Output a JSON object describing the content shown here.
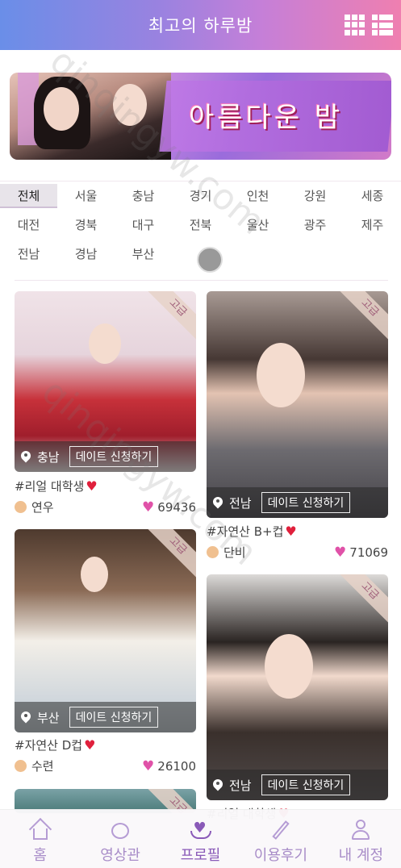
{
  "header": {
    "title": "최고의 하루밤",
    "icons": [
      "grid-icon",
      "list-icon"
    ]
  },
  "banner": {
    "text": "아름다운 밤"
  },
  "regions": {
    "rows": [
      [
        "전체",
        "서울",
        "충남",
        "경기",
        "인천",
        "강원",
        "세종"
      ],
      [
        "대전",
        "경북",
        "대구",
        "전북",
        "울산",
        "광주",
        "제주"
      ],
      [
        "전남",
        "경남",
        "부산"
      ]
    ],
    "active": "전체"
  },
  "cards": [
    {
      "tag": "고급",
      "location": "충남",
      "button": "데이트 신청하기",
      "desc": "#리얼 대학생",
      "name": "연우",
      "likes": "69436"
    },
    {
      "tag": "고급",
      "location": "전남",
      "button": "데이트 신청하기",
      "desc": "#자연산 B+컵",
      "name": "단비",
      "likes": "71069"
    },
    {
      "tag": "고급",
      "location": "부산",
      "button": "데이트 신청하기",
      "desc": "#자연산 D컵",
      "name": "수련",
      "likes": "26100"
    },
    {
      "tag": "고급",
      "location": "전남",
      "button": "데이트 신청하기",
      "desc": "#리얼 대학생"
    },
    {
      "tag": "고급"
    }
  ],
  "nav": [
    {
      "label": "홈",
      "icon": "home-icon"
    },
    {
      "label": "영상관",
      "icon": "video-hall-icon"
    },
    {
      "label": "프로필",
      "icon": "profile-heart-icon",
      "active": true
    },
    {
      "label": "이용후기",
      "icon": "pencil-icon"
    },
    {
      "label": "내 계정",
      "icon": "user-icon"
    }
  ],
  "watermark": "qinqingyw.com",
  "colors": {
    "header_start": "#6a8ee8",
    "header_end": "#ef7fb0",
    "nav_accent": "#8a5ab8",
    "like_heart": "#e052a8",
    "desc_heart": "#e0203c"
  }
}
